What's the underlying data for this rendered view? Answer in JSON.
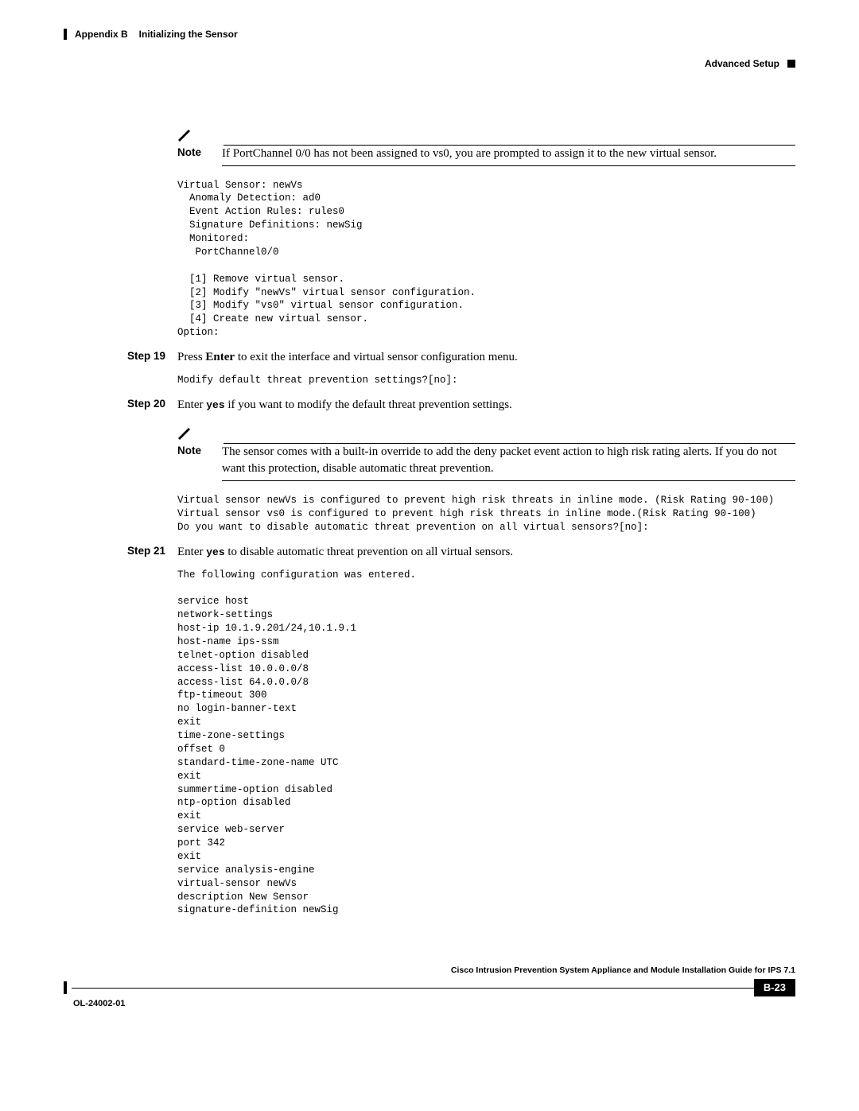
{
  "header": {
    "appendix": "Appendix B",
    "title": "Initializing the Sensor",
    "section": "Advanced Setup"
  },
  "notes": {
    "label": "Note",
    "n1": "If PortChannel 0/0 has not been assigned to vs0, you are prompted to assign it to the new virtual sensor.",
    "n2": "The sensor comes with a built-in override to add the deny packet event action to high risk rating alerts. If you do not want this protection, disable automatic threat prevention."
  },
  "code": {
    "c1": "Virtual Sensor: newVs\n  Anomaly Detection: ad0\n  Event Action Rules: rules0\n  Signature Definitions: newSig\n  Monitored:\n   PortChannel0/0\n\n  [1] Remove virtual sensor.\n  [2] Modify \"newVs\" virtual sensor configuration.\n  [3] Modify \"vs0\" virtual sensor configuration.\n  [4] Create new virtual sensor.\nOption:",
    "c2": "Modify default threat prevention settings?[no]:",
    "c3": "Virtual sensor newVs is configured to prevent high risk threats in inline mode. (Risk Rating 90-100)\nVirtual sensor vs0 is configured to prevent high risk threats in inline mode.(Risk Rating 90-100)\nDo you want to disable automatic threat prevention on all virtual sensors?[no]:",
    "c4": "The following configuration was entered.\n\nservice host\nnetwork-settings\nhost-ip 10.1.9.201/24,10.1.9.1\nhost-name ips-ssm\ntelnet-option disabled\naccess-list 10.0.0.0/8\naccess-list 64.0.0.0/8\nftp-timeout 300\nno login-banner-text\nexit\ntime-zone-settings\noffset 0\nstandard-time-zone-name UTC\nexit\nsummertime-option disabled\nntp-option disabled\nexit\nservice web-server\nport 342\nexit\nservice analysis-engine\nvirtual-sensor newVs\ndescription New Sensor\nsignature-definition newSig"
  },
  "steps": {
    "s19": {
      "label": "Step 19",
      "pre": "Press ",
      "kw": "Enter",
      "post": " to exit the interface and virtual sensor configuration menu."
    },
    "s20": {
      "label": "Step 20",
      "pre": "Enter ",
      "kw": "yes",
      "post": " if you want to modify the default threat prevention settings."
    },
    "s21": {
      "label": "Step 21",
      "pre": "Enter ",
      "kw": "yes",
      "post": " to disable automatic threat prevention on all virtual sensors."
    }
  },
  "footer": {
    "guide": "Cisco Intrusion Prevention System Appliance and Module Installation Guide for IPS 7.1",
    "doc": "OL-24002-01",
    "page": "B-23"
  }
}
